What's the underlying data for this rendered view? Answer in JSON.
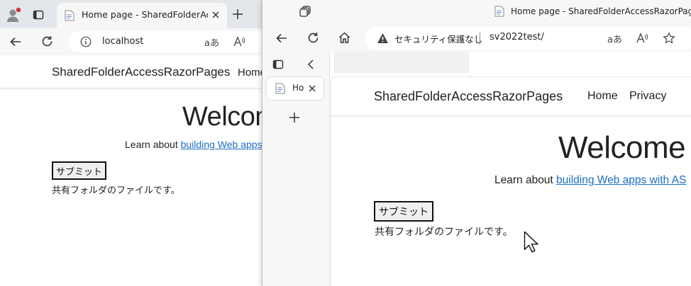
{
  "back_window": {
    "tab_title": "Home page - SharedFolderAccessRazorPages",
    "address": "localhost",
    "site": {
      "brand": "SharedFolderAccessRazorPages",
      "nav_home": "Home",
      "welcome": "Welcome",
      "lead_prefix": "Learn about ",
      "lead_link": "building Web apps",
      "submit_label": "サブミット",
      "file_text": "共有フォルダのファイルです。"
    }
  },
  "front_window": {
    "window_title": "Home page - SharedFolderAccessRazorPages",
    "security_label": "セキュリティ保護なし",
    "address": "sv2022test/",
    "vertical_tab_title": "Ho",
    "site": {
      "brand": "SharedFolderAccessRazorPages",
      "nav_home": "Home",
      "nav_privacy": "Privacy",
      "welcome": "Welcome",
      "lead_prefix": "Learn about ",
      "lead_link": "building Web apps with AS",
      "submit_label": "サブミット",
      "file_text": "共有フォルダのファイルです。"
    }
  },
  "icons": {
    "profile": "profile-avatar-icon",
    "tab_actions": "tab-actions-icon",
    "favicon": "page-favicon-icon",
    "close": "close-icon",
    "new_tab": "plus-icon",
    "back": "back-arrow-icon",
    "refresh": "refresh-icon",
    "home": "home-icon",
    "info": "info-icon",
    "warning": "warning-icon",
    "read_aloud": "read-aloud-icon",
    "immersive": "immersive-reader-icon",
    "favorite": "star-icon",
    "workspaces": "workspaces-icon",
    "sidebar_toggle": "sidebar-panel-icon",
    "collapse": "chevron-left-icon",
    "cursor": "mouse-pointer-icon"
  },
  "colors": {
    "link": "#1b6ec2",
    "chrome": "#f7f7f7",
    "tabbar": "#e3e6ea",
    "profile_badge": "#d13438"
  }
}
